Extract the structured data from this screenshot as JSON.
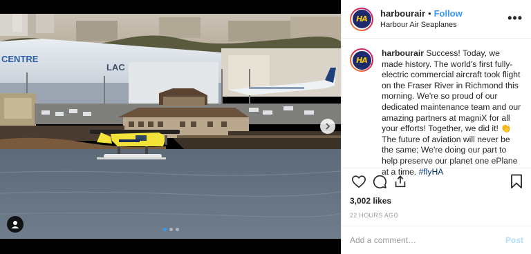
{
  "post": {
    "username": "harbourair",
    "separator": "•",
    "follow_label": "Follow",
    "location": "Harbour Air Seaplanes",
    "more_icon": "more-options-icon",
    "avatar_text": "HA",
    "caption": {
      "username": "harbourair",
      "text_before_emoji": "Success! Today, we made history. The world's first fully-electric commercial aircraft took flight on the Fraser River in Richmond this morning. We're so proud of our dedicated maintenance team and our amazing partners at magniX for all your efforts! Together, we did it!",
      "emoji": "👏",
      "text_after_emoji": "The future of aviation will never be the same; We're doing our part to help preserve our planet one ePlane at a time.",
      "hashtag": "#flyHA"
    },
    "likes": "3,002 likes",
    "timestamp": "22 HOURS AGO",
    "comment_placeholder": "Add a comment…",
    "post_label": "Post"
  },
  "media": {
    "carousel_slides": 3,
    "active_slide": 1,
    "hangar_sign_1": "CENTRE",
    "hangar_sign_2": "LAC"
  },
  "colors": {
    "accent": "#3897f0",
    "post_disabled": "#b2dffc",
    "hashtag": "#003569",
    "muted": "#999999"
  }
}
